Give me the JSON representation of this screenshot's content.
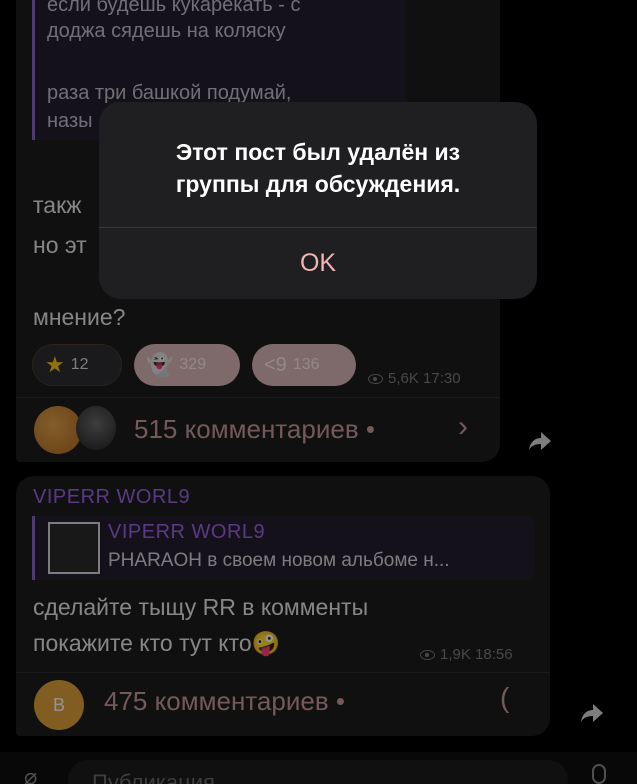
{
  "post1": {
    "quote_lines": [
      "если будешь кукарекать - с",
      "доджа сядешь на коляску",
      "раза три башкой подумай,",
      "назы"
    ],
    "body_lines": [
      "такж",
      "но эт",
      "мнение?"
    ],
    "reactions": [
      {
        "emoji": "star",
        "count": "12"
      },
      {
        "emoji": "👻",
        "count": "329"
      },
      {
        "emoji": "<9",
        "count": "136"
      }
    ],
    "views": "5,6K",
    "time": "17:30",
    "comments": "515 комментариев •"
  },
  "post2": {
    "author": "VIPERR WORL9",
    "reply_author": "VIPERR WORL9",
    "reply_text": "PHARAOH в своем новом альбоме н...",
    "body_lines": [
      "сделайте тыщу RR в комменты",
      "покажите кто тут кто🤪"
    ],
    "views": "1,9K",
    "time": "18:56",
    "avatar_letter": "B",
    "comments": "475 комментариев •",
    "loading": "("
  },
  "input": {
    "placeholder": "Публикация"
  },
  "dialog": {
    "message_line1": "Этот пост был удалён из",
    "message_line2": "группы для обсуждения.",
    "ok": "OK"
  }
}
